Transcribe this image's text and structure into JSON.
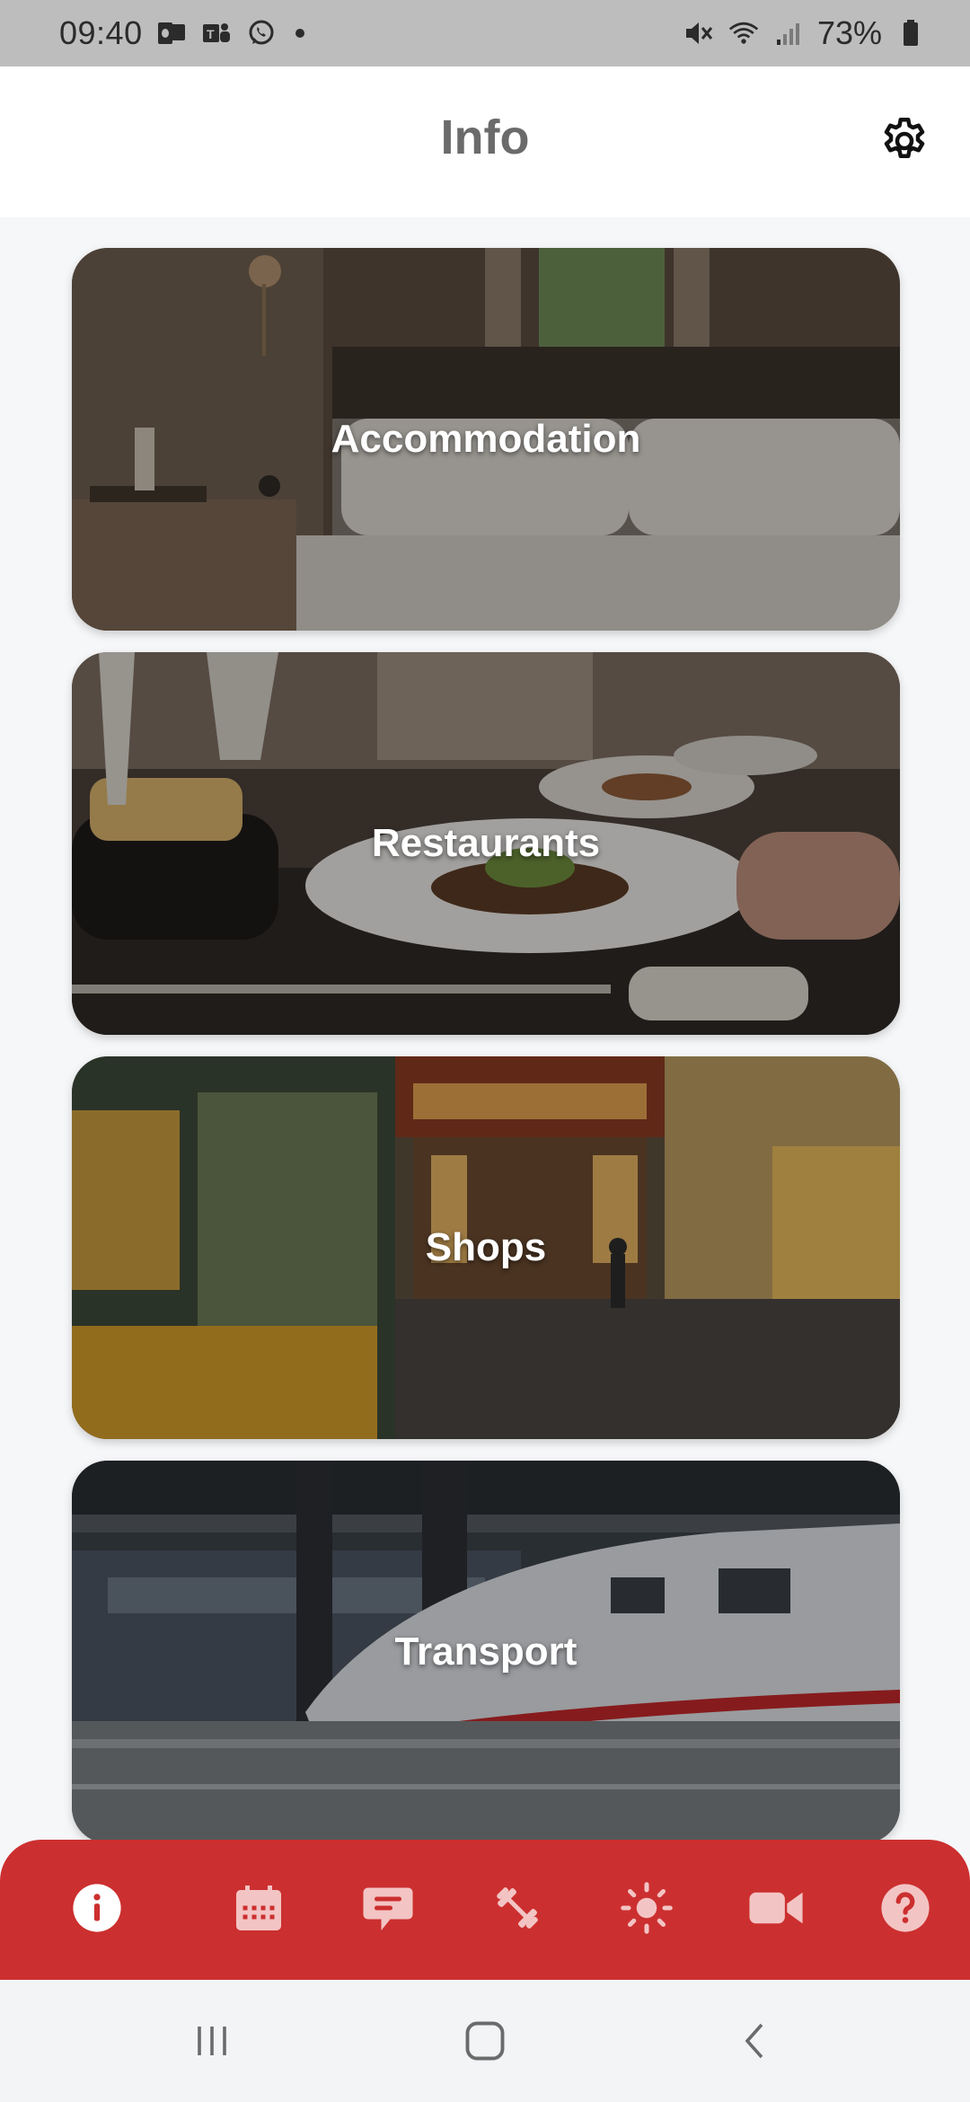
{
  "status_bar": {
    "time": "09:40",
    "battery": "73%",
    "icons_left": [
      "outlook-icon",
      "teams-icon",
      "whatsapp-icon",
      "notification-dot"
    ],
    "icons_right": [
      "mute-icon",
      "wifi-icon",
      "signal-icon",
      "battery-icon"
    ]
  },
  "header": {
    "title": "Info",
    "settings_icon": "gear-icon"
  },
  "cards": [
    {
      "label": "Accommodation"
    },
    {
      "label": "Restaurants"
    },
    {
      "label": "Shops"
    },
    {
      "label": "Transport"
    }
  ],
  "bottom_nav": {
    "items": [
      {
        "icon": "info-icon",
        "active": true
      },
      {
        "icon": "calendar-icon",
        "active": false
      },
      {
        "icon": "chat-icon",
        "active": false
      },
      {
        "icon": "fitness-icon",
        "active": false
      },
      {
        "icon": "sun-icon",
        "active": false
      },
      {
        "icon": "video-icon",
        "active": false
      },
      {
        "icon": "help-icon",
        "active": false
      }
    ],
    "active_color": "#ffffff",
    "inactive_color": "#f3c4c4",
    "bar_color": "#cc2f2f"
  },
  "system_nav": {
    "items": [
      "recents-icon",
      "home-icon",
      "back-icon"
    ]
  }
}
